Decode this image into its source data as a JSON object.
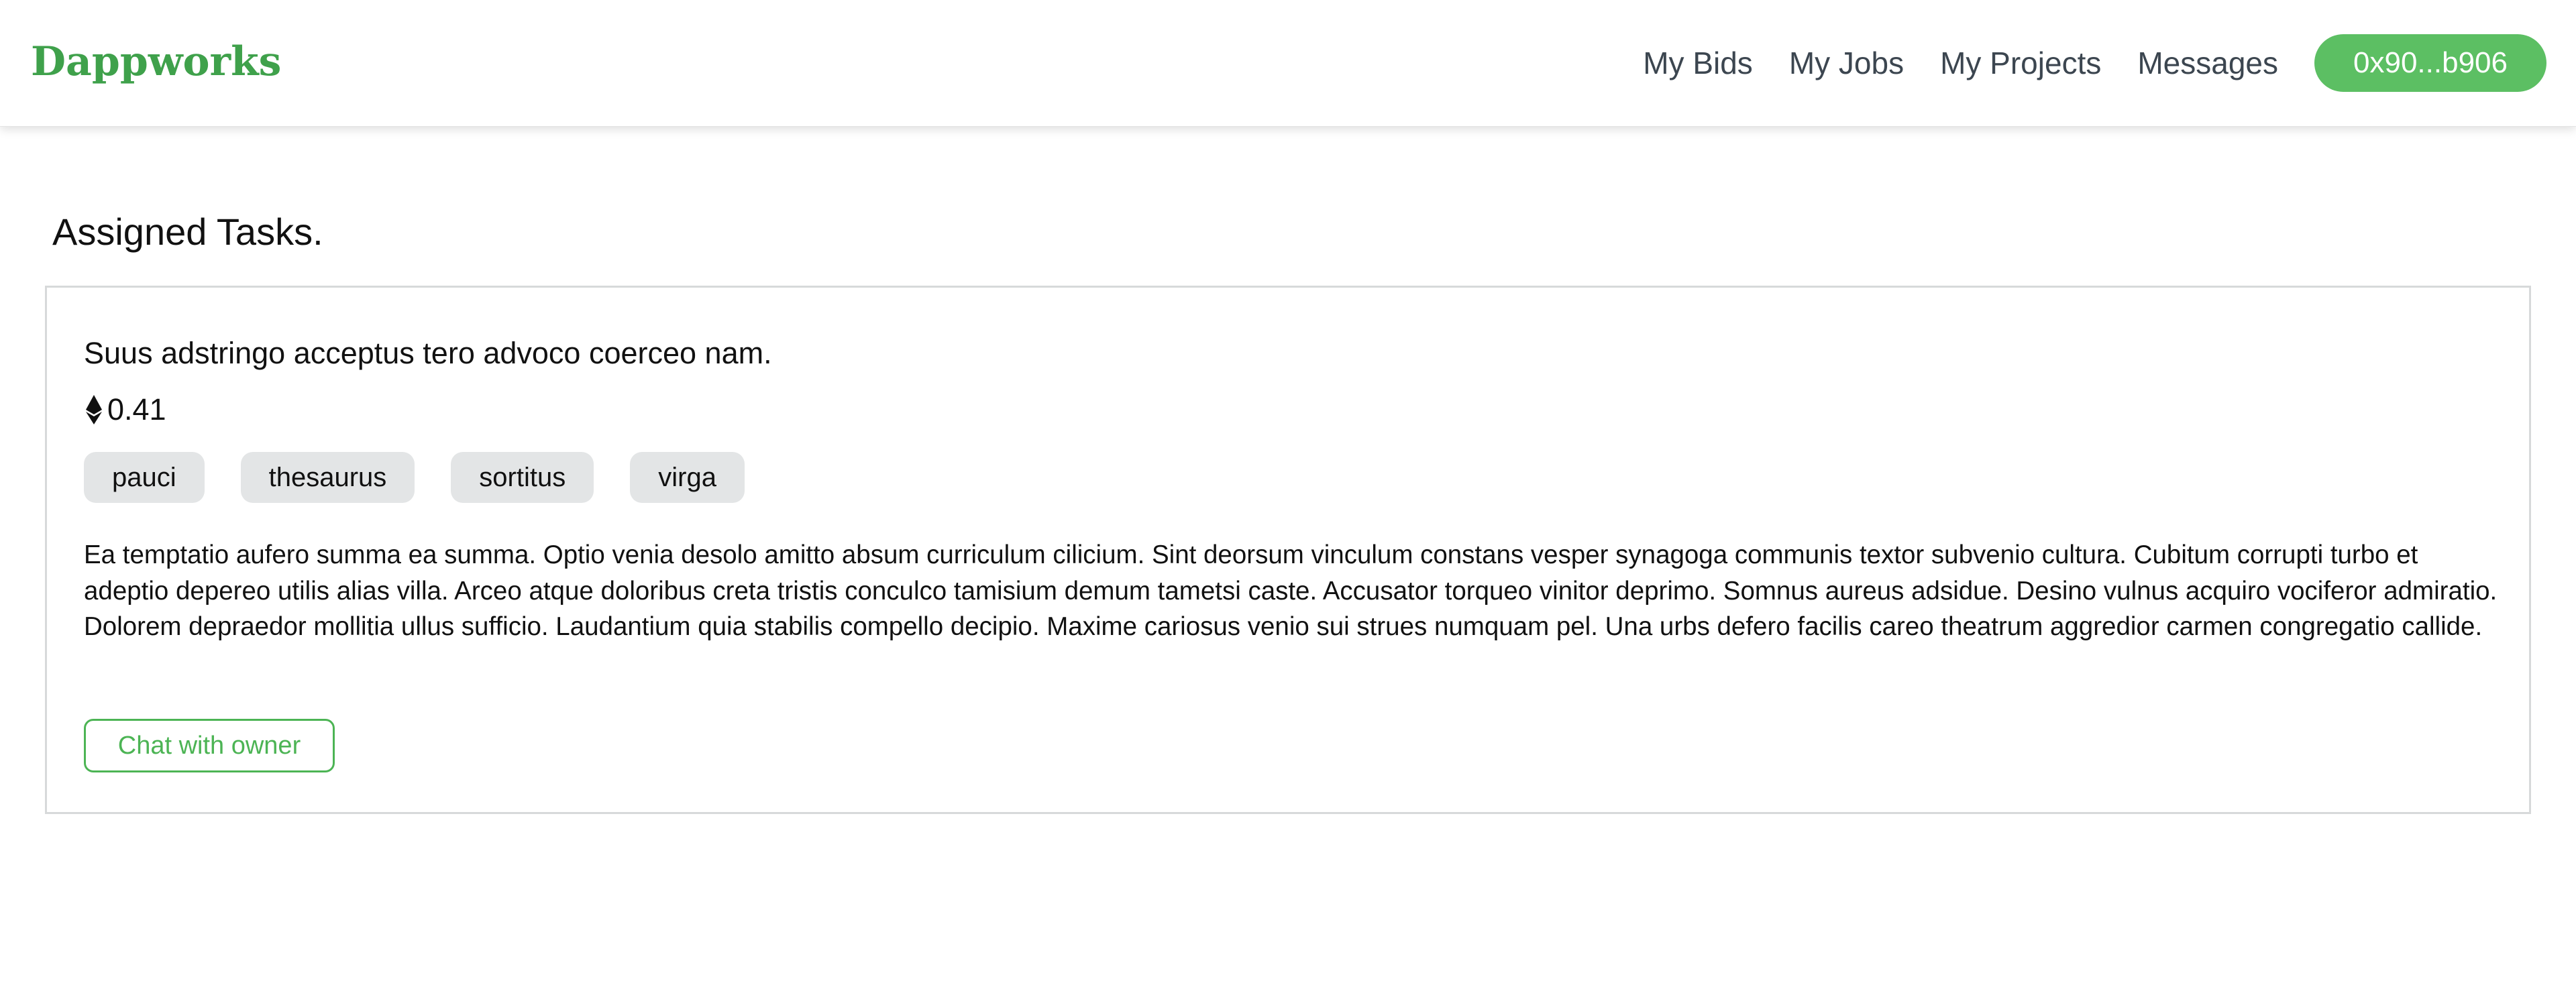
{
  "navbar": {
    "brand": "Dappworks",
    "links": [
      {
        "label": "My Bids"
      },
      {
        "label": "My Jobs"
      },
      {
        "label": "My Projects"
      },
      {
        "label": "Messages"
      }
    ],
    "wallet_address": "0x90...b906"
  },
  "main": {
    "title": "Assigned Tasks.",
    "tasks": [
      {
        "title": "Suus adstringo acceptus tero advoco coerceo nam.",
        "price_icon": "ethereum-icon",
        "price": "0.41",
        "tags": [
          "pauci",
          "thesaurus",
          "sortitus",
          "virga"
        ],
        "description": "Ea temptatio aufero summa ea summa. Optio venia desolo amitto absum curriculum cilicium. Sint deorsum vinculum constans vesper synagoga communis textor subvenio cultura. Cubitum corrupti turbo et adeptio depereo utilis alias villa. Arceo atque doloribus creta tristis conculco tamisium demum tametsi caste. Accusator torqueo vinitor deprimo. Somnus aureus adsidue. Desino vulnus acquiro vociferor admiratio. Dolorem depraedor mollitia ullus sufficio. Laudantium quia stabilis compello decipio. Maxime cariosus venio sui strues numquam pel. Una urbs defero facilis careo theatrum aggredior carmen congregatio callide.",
        "chat_button": "Chat with owner"
      }
    ]
  },
  "colors": {
    "brand": "#3fa14b",
    "accent": "#5cbf63",
    "tag_bg": "#e3e5e6",
    "nav_text": "#3c4650"
  }
}
